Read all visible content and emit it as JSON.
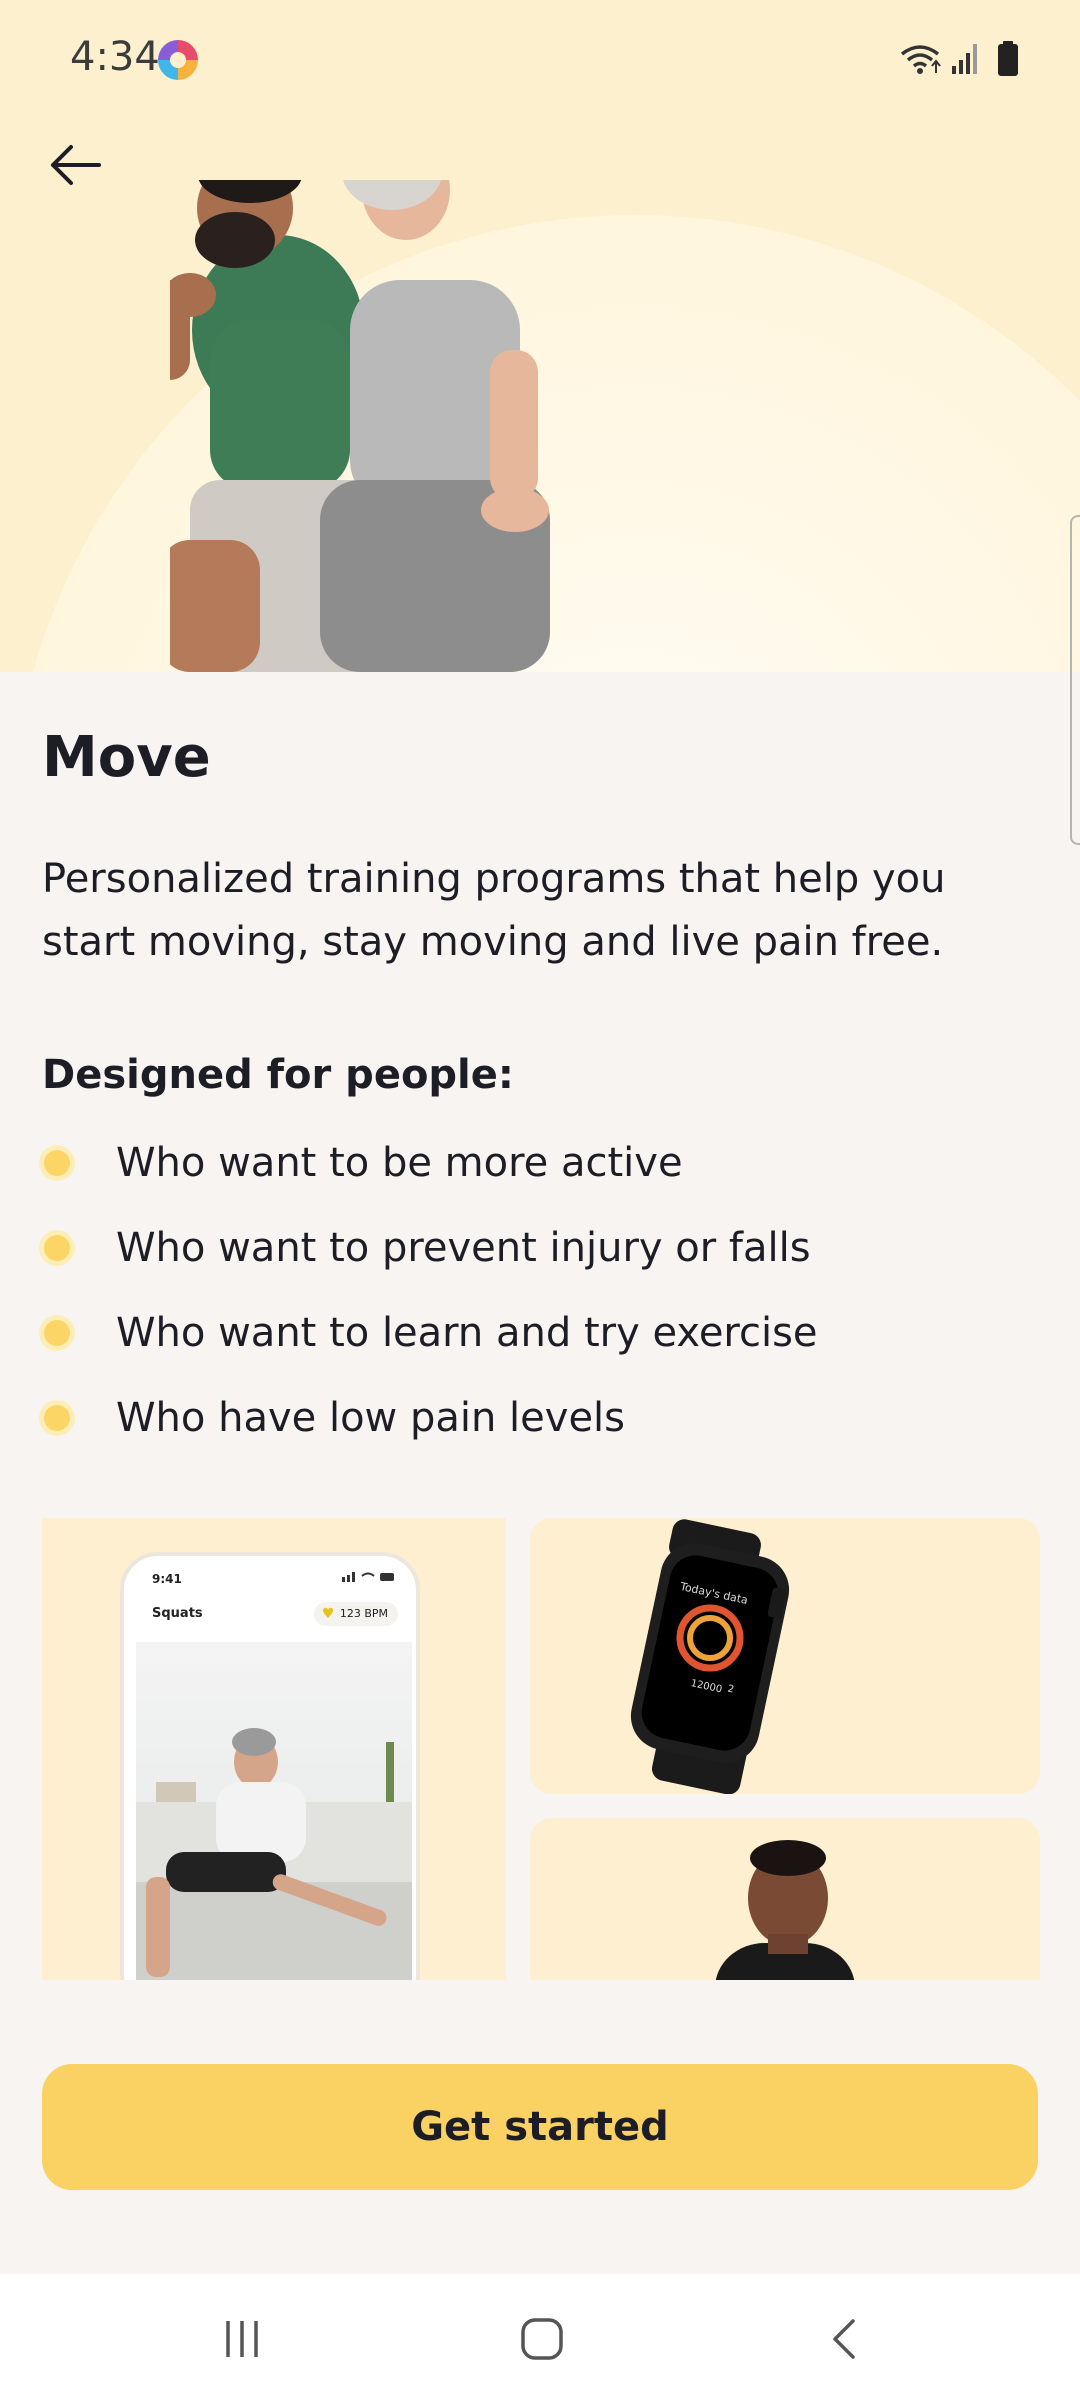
{
  "status_bar": {
    "time": "4:34"
  },
  "icons": {
    "back": "back-arrow-icon",
    "wifi": "wifi-icon",
    "signal": "signal-icon",
    "battery": "battery-icon",
    "nav_recents": "recents-icon",
    "nav_home": "home-icon",
    "nav_back": "back-icon"
  },
  "colors": {
    "hero_bg": "#fdf0cf",
    "page_bg": "#f7f4f1",
    "accent": "#fad263",
    "bullet": "#fbd566"
  },
  "content": {
    "title": "Move",
    "description": "Personalized training programs that help you start moving, stay moving and live pain free.",
    "designed_heading": "Designed for people:",
    "bullets": [
      "Who want to be more active",
      "Who want to prevent injury or falls",
      "Who want to learn and try exercise",
      "Who have low pain levels"
    ]
  },
  "phone_mockup": {
    "time": "9:41",
    "title": "Squats",
    "bpm": "123 BPM"
  },
  "watch_mockup": {
    "heading": "Today's data",
    "steps": "12000",
    "count": "2"
  },
  "cta": {
    "label": "Get started"
  }
}
